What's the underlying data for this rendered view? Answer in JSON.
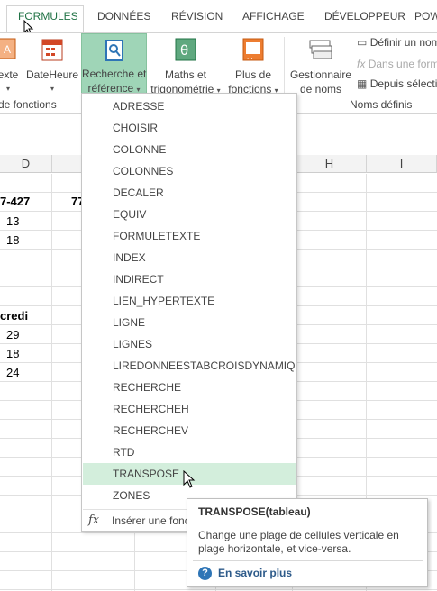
{
  "tabs": [
    {
      "label": "FORMULES",
      "active": true
    },
    {
      "label": "DONNÉES"
    },
    {
      "label": "RÉVISION"
    },
    {
      "label": "AFFICHAGE"
    },
    {
      "label": "DÉVELOPPEUR"
    },
    {
      "label": "POW"
    }
  ],
  "ribbon": {
    "text_button": "exte",
    "datetime_button": "DateHeure",
    "lookup_button": {
      "line1": "Recherche et",
      "line2": "référence"
    },
    "math_button": {
      "line1": "Maths et",
      "line2": "trigonométrie"
    },
    "more_button": {
      "line1": "Plus de",
      "line2": "fonctions"
    },
    "name_manager": {
      "line1": "Gestionnaire",
      "line2": "de noms"
    },
    "define_name": "Définir un nom",
    "use_in_formula": "Dans une form",
    "create_from_selection": "Depuis sélecti",
    "group_function_library": "de fonctions",
    "group_defined_names": "Noms définis",
    "colors": {
      "accent": "#217346",
      "lookup_selected_bg": "#9fd5b7"
    }
  },
  "grid": {
    "columns": [
      "D",
      "",
      "",
      "",
      "",
      "H",
      "I"
    ],
    "cells": {
      "d1": "7-427",
      "e1": "77",
      "d2": "13",
      "d3": "18",
      "d5": "credi",
      "d6": "29",
      "d7": "18",
      "d8": "24"
    }
  },
  "dropdown": {
    "items": [
      "ADRESSE",
      "CHOISIR",
      "COLONNE",
      "COLONNES",
      "DECALER",
      "EQUIV",
      "FORMULETEXTE",
      "INDEX",
      "INDIRECT",
      "LIEN_HYPERTEXTE",
      "LIGNE",
      "LIGNES",
      "LIREDONNEESTABCROISDYNAMIQUE",
      "RECHERCHE",
      "RECHERCHEH",
      "RECHERCHEV",
      "RTD",
      "TRANSPOSE",
      "ZONES"
    ],
    "highlighted": "TRANSPOSE",
    "footer_icon": "fx",
    "footer_label": "Insérer une fonc"
  },
  "tooltip": {
    "title": "TRANSPOSE(tableau)",
    "body": "Change une plage de cellules verticale en plage horizontale, et vice-versa.",
    "help_icon": "?",
    "help_link": "En savoir plus"
  }
}
